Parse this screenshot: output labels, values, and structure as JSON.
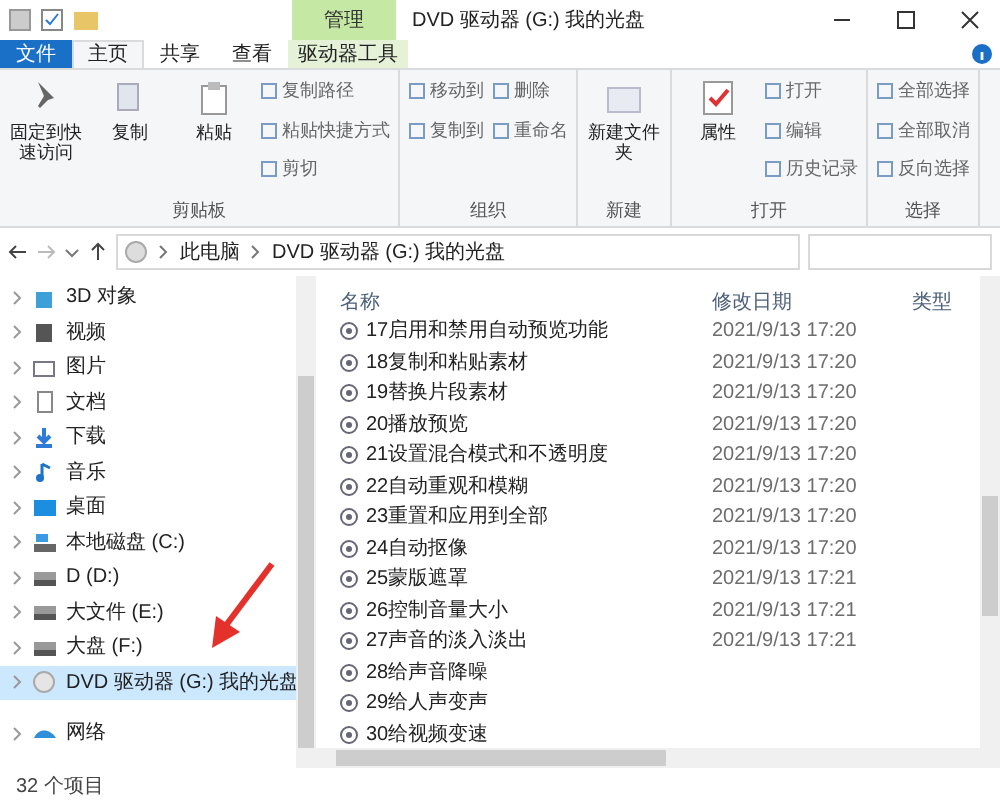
{
  "window": {
    "title": "DVD 驱动器 (G:) 我的光盘",
    "context_tab": "管理"
  },
  "tabs": [
    {
      "label": "文件",
      "kind": "file",
      "selected": false
    },
    {
      "label": "主页",
      "kind": "tab",
      "selected": true
    },
    {
      "label": "共享",
      "kind": "tab",
      "selected": false
    },
    {
      "label": "查看",
      "kind": "tab",
      "selected": false
    },
    {
      "label": "驱动器工具",
      "kind": "tab",
      "selected": false
    }
  ],
  "ribbon": [
    {
      "label": "剪贴板",
      "large": [
        "固定到快速访问",
        "复制",
        "粘贴"
      ],
      "small": [
        "复制路径",
        "粘贴快捷方式",
        "剪切"
      ]
    },
    {
      "label": "组织",
      "small": [
        "移动到",
        "复制到",
        "删除",
        "重命名"
      ]
    },
    {
      "label": "新建",
      "large": [
        "新建文件夹"
      ]
    },
    {
      "label": "打开",
      "large": [
        "属性"
      ],
      "small": [
        "打开",
        "编辑",
        "历史记录"
      ]
    },
    {
      "label": "选择",
      "small": [
        "全部选择",
        "全部取消",
        "反向选择"
      ]
    }
  ],
  "address": {
    "path": [
      "此电脑",
      "DVD 驱动器 (G:) 我的光盘"
    ]
  },
  "sidebar": {
    "items": [
      {
        "label": "3D 对象",
        "kind": "folder3d",
        "selected": false
      },
      {
        "label": "视频",
        "kind": "video",
        "selected": false
      },
      {
        "label": "图片",
        "kind": "pictures",
        "selected": false
      },
      {
        "label": "文档",
        "kind": "docs",
        "selected": false
      },
      {
        "label": "下载",
        "kind": "download",
        "selected": false
      },
      {
        "label": "音乐",
        "kind": "music",
        "selected": false
      },
      {
        "label": "桌面",
        "kind": "desktop",
        "selected": false
      },
      {
        "label": "本地磁盘 (C:)",
        "kind": "system",
        "selected": false
      },
      {
        "label": "D (D:)",
        "kind": "drive",
        "selected": false
      },
      {
        "label": "大文件 (E:)",
        "kind": "drive",
        "selected": false
      },
      {
        "label": "大盘 (F:)",
        "kind": "drive",
        "selected": false
      },
      {
        "label": "DVD 驱动器 (G:) 我的光盘",
        "kind": "dvd",
        "selected": true
      },
      {
        "label": "网络",
        "kind": "network",
        "selected": false
      }
    ]
  },
  "table": {
    "columns": [
      "名称",
      "修改日期",
      "类型"
    ],
    "rows": [
      {
        "name": "17启用和禁用自动预览功能",
        "date": "2021/9/13 17:20"
      },
      {
        "name": "18复制和粘贴素材",
        "date": "2021/9/13 17:20"
      },
      {
        "name": "19替换片段素材",
        "date": "2021/9/13 17:20"
      },
      {
        "name": "20播放预览",
        "date": "2021/9/13 17:20"
      },
      {
        "name": "21设置混合模式和不透明度",
        "date": "2021/9/13 17:20"
      },
      {
        "name": "22自动重观和模糊",
        "date": "2021/9/13 17:20"
      },
      {
        "name": "23重置和应用到全部",
        "date": "2021/9/13 17:20"
      },
      {
        "name": "24自动抠像",
        "date": "2021/9/13 17:20"
      },
      {
        "name": "25蒙版遮罩",
        "date": "2021/9/13 17:21"
      },
      {
        "name": "26控制音量大小",
        "date": "2021/9/13 17:21"
      },
      {
        "name": "27声音的淡入淡出",
        "date": "2021/9/13 17:21"
      },
      {
        "name": "28给声音降噪"
      },
      {
        "name": "29给人声变声"
      },
      {
        "name": "30给视频变速"
      }
    ]
  },
  "status_bar": "32 个项目"
}
